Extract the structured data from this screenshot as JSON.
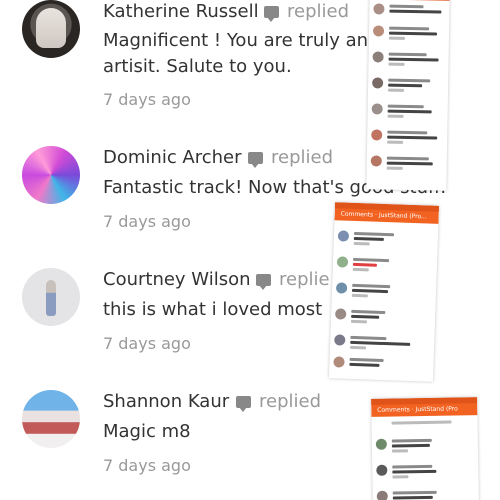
{
  "comments": [
    {
      "name": "Katherine Russell",
      "action": "replied",
      "text": "Magnificent ! You are truly an e",
      "text2": "artisit. Salute to you.",
      "time": "7 days ago"
    },
    {
      "name": "Dominic Archer",
      "action": "replied",
      "text": "Fantastic track! Now that's good stuff.",
      "text2": "",
      "time": "7 days ago"
    },
    {
      "name": "Courtney Wilson",
      "action": "replie",
      "text": "this is what i loved most",
      "text2": "",
      "time": "7 days ago"
    },
    {
      "name": "Shannon Kaur",
      "action": "replied",
      "text": "Magic m8",
      "text2": "",
      "time": "7 days ago"
    }
  ],
  "overlay": {
    "header_title": "Comments · JustStand (Pro...",
    "header_title_alt": "Comments · JustStand (Pro"
  },
  "colors": {
    "accent": "#f26322",
    "text": "#333333",
    "muted": "#999999"
  }
}
